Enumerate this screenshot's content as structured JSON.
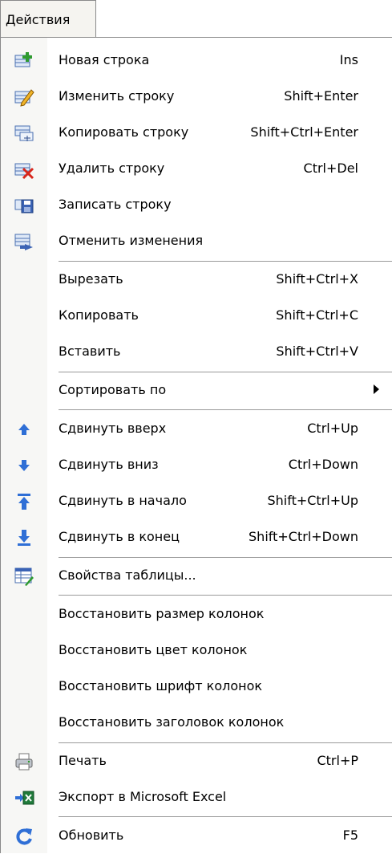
{
  "menu_title": "Действия",
  "items": [
    {
      "label": "Новая строка",
      "shortcut": "Ins",
      "icon": "new-row-icon"
    },
    {
      "label": "Изменить строку",
      "shortcut": "Shift+Enter",
      "icon": "edit-row-icon"
    },
    {
      "label": "Копировать строку",
      "shortcut": "Shift+Ctrl+Enter",
      "icon": "copy-row-icon"
    },
    {
      "label": "Удалить строку",
      "shortcut": "Ctrl+Del",
      "icon": "delete-row-icon"
    },
    {
      "label": "Записать строку",
      "shortcut": "",
      "icon": "save-row-icon"
    },
    {
      "label": "Отменить изменения",
      "shortcut": "",
      "icon": "undo-changes-icon"
    },
    {
      "label": "Вырезать",
      "shortcut": "Shift+Ctrl+X"
    },
    {
      "label": "Копировать",
      "shortcut": "Shift+Ctrl+C"
    },
    {
      "label": "Вставить",
      "shortcut": "Shift+Ctrl+V"
    },
    {
      "label": "Сортировать по",
      "shortcut": ""
    },
    {
      "label": "Сдвинуть вверх",
      "shortcut": "Ctrl+Up",
      "icon": "move-up-icon"
    },
    {
      "label": "Сдвинуть вниз",
      "shortcut": "Ctrl+Down",
      "icon": "move-down-icon"
    },
    {
      "label": "Сдвинуть в начало",
      "shortcut": "Shift+Ctrl+Up",
      "icon": "move-top-icon"
    },
    {
      "label": "Сдвинуть в конец",
      "shortcut": "Shift+Ctrl+Down",
      "icon": "move-bottom-icon"
    },
    {
      "label": "Свойства таблицы...",
      "shortcut": "",
      "icon": "table-properties-icon"
    },
    {
      "label": "Восстановить размер колонок",
      "shortcut": ""
    },
    {
      "label": "Восстановить цвет колонок",
      "shortcut": ""
    },
    {
      "label": "Восстановить шрифт колонок",
      "shortcut": ""
    },
    {
      "label": "Восстановить заголовок колонок",
      "shortcut": ""
    },
    {
      "label": "Печать",
      "shortcut": "Ctrl+P",
      "icon": "printer-icon"
    },
    {
      "label": "Экспорт в Microsoft Excel",
      "shortcut": "",
      "icon": "excel-export-icon"
    },
    {
      "label": "Обновить",
      "shortcut": "F5",
      "icon": "refresh-icon"
    }
  ]
}
